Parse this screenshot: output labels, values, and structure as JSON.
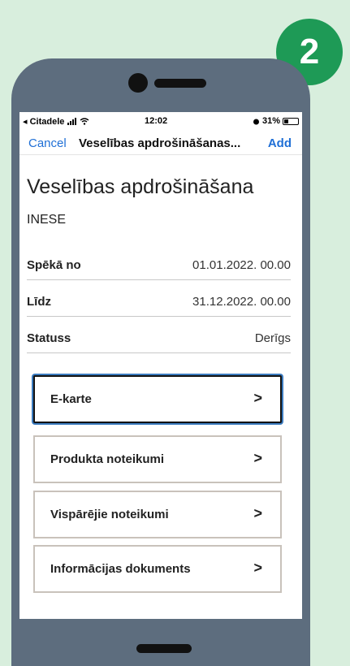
{
  "step_badge": "2",
  "status_bar": {
    "carrier": "◂ Citadele",
    "time": "12:02",
    "battery_percent": "31%"
  },
  "nav": {
    "cancel_label": "Cancel",
    "title": "Veselības apdrošināšanas...",
    "add_label": "Add"
  },
  "page": {
    "title": "Veselības apdrošināšana",
    "owner": "INESE"
  },
  "details": [
    {
      "label": "Spēkā no",
      "value": "01.01.2022. 00.00"
    },
    {
      "label": "Līdz",
      "value": "31.12.2022. 00.00"
    },
    {
      "label": "Statuss",
      "value": "Derīgs"
    }
  ],
  "links": [
    {
      "label": "E-karte",
      "chevron": ">"
    },
    {
      "label": "Produkta noteikumi",
      "chevron": ">"
    },
    {
      "label": "Vispārējie noteikumi",
      "chevron": ">"
    },
    {
      "label": "Informācijas dokuments",
      "chevron": ">"
    }
  ],
  "colors": {
    "background": "#d8eedd",
    "badge": "#1e9a56",
    "phone_body": "#5d6d7e",
    "ios_link": "#1f6fd6"
  }
}
